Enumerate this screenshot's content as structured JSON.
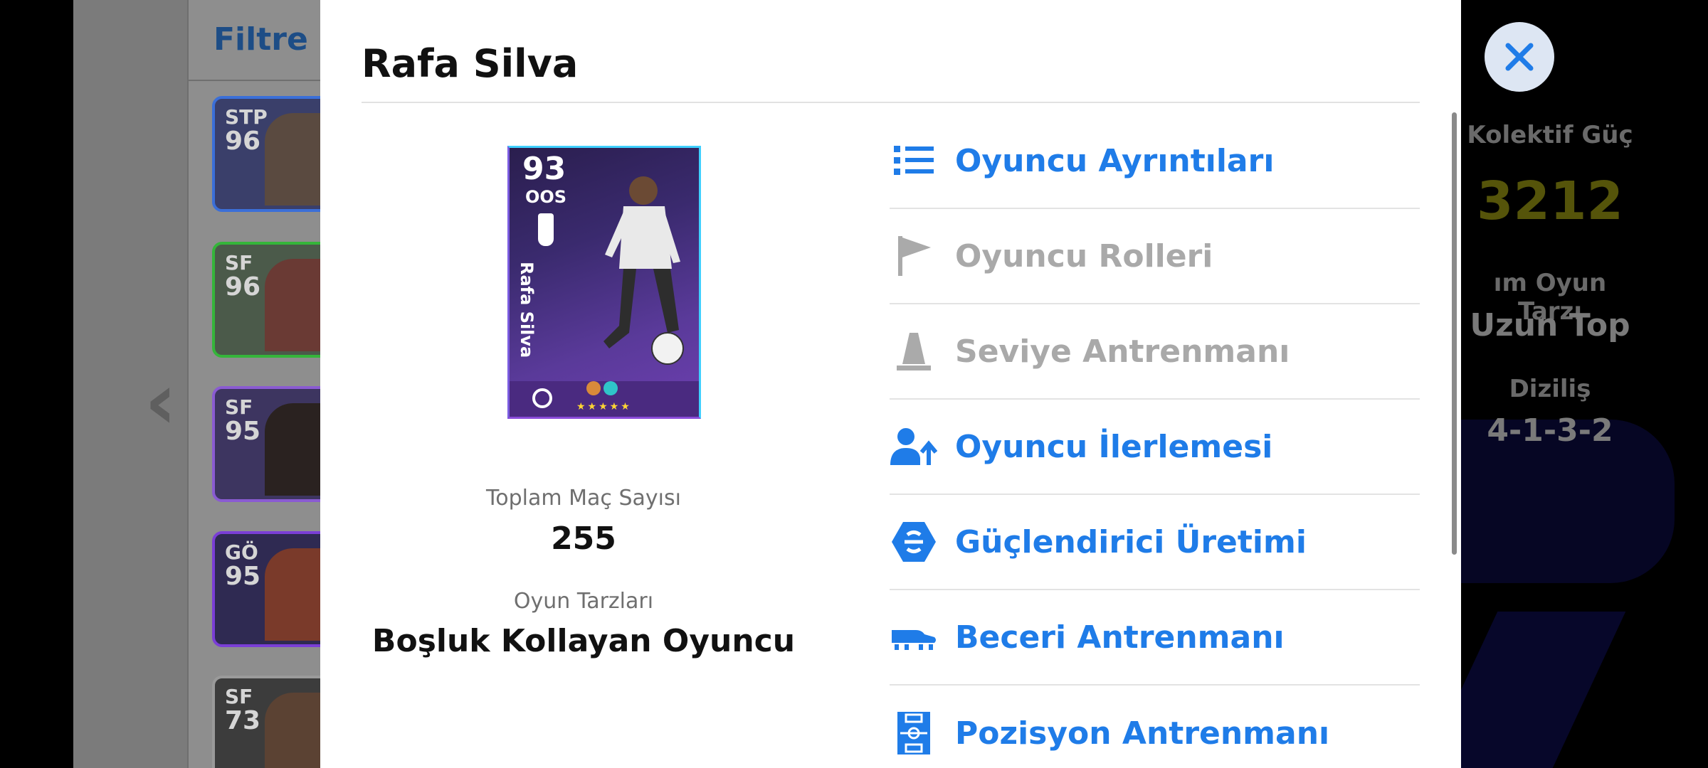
{
  "background": {
    "filter_label": "Filtre",
    "cards": [
      {
        "position": "STP",
        "rating": "96",
        "border": "#3b6fd8"
      },
      {
        "position": "SF",
        "rating": "96",
        "border": "#35b53a"
      },
      {
        "position": "SF",
        "rating": "95",
        "border": "#8a5bd2"
      },
      {
        "position": "GÖ",
        "rating": "95",
        "border": "#7a3ed6"
      },
      {
        "position": "SF",
        "rating": "73",
        "border": "#9a9a9a"
      }
    ],
    "team_strength_label": "Kolektif Güç",
    "team_strength_value": "3212",
    "playstyle_label": "ım Oyun Tarzı",
    "playstyle_value": "Uzun Top",
    "formation_label": "Diziliş",
    "formation_value": "4-1-3-2"
  },
  "modal": {
    "title": "Rafa Silva",
    "card": {
      "rating": "93",
      "position": "OOS",
      "name": "Rafa Silva",
      "stars": "★★★★★"
    },
    "total_matches_label": "Toplam Maç Sayısı",
    "total_matches_value": "255",
    "playstyles_label": "Oyun Tarzları",
    "playstyles_value": "Boşluk Kollayan Oyuncu",
    "menu": [
      {
        "label": "Oyuncu Ayrıntıları",
        "icon": "list-icon",
        "state": "active"
      },
      {
        "label": "Oyuncu Rolleri",
        "icon": "flag-icon",
        "state": "disabled"
      },
      {
        "label": "Seviye Antrenmanı",
        "icon": "cone-icon",
        "state": "disabled"
      },
      {
        "label": "Oyuncu İlerlemesi",
        "icon": "user-progress-icon",
        "state": "active"
      },
      {
        "label": "Güçlendirici Üretimi",
        "icon": "booster-icon",
        "state": "active"
      },
      {
        "label": "Beceri Antrenmanı",
        "icon": "boot-icon",
        "state": "active"
      },
      {
        "label": "Pozisyon Antrenmanı",
        "icon": "pitch-icon",
        "state": "active"
      }
    ],
    "colors": {
      "accent": "#1f7ce8",
      "disabled": "#a9a9a9"
    }
  }
}
